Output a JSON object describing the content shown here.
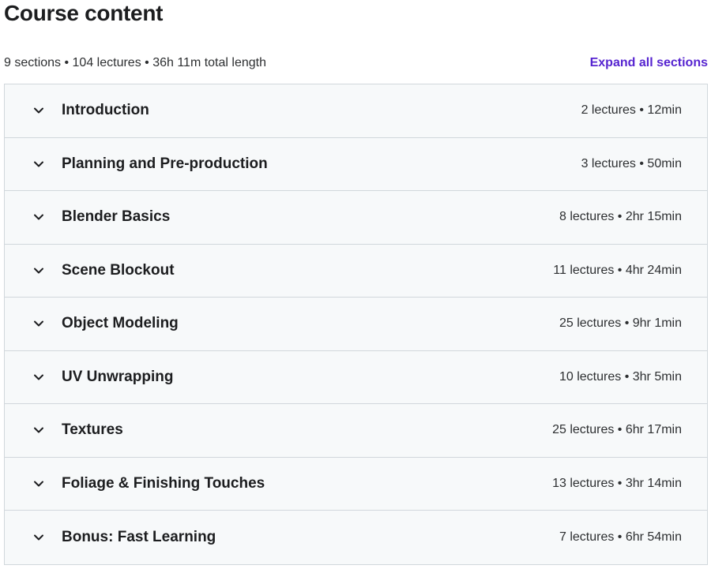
{
  "header": {
    "title": "Course content",
    "summary": "9 sections • 104 lectures • 36h 11m total length",
    "expand_label": "Expand all sections"
  },
  "colors": {
    "accent": "#5624d0",
    "section_bg": "#f7f9fa",
    "border": "#d1d7dc"
  },
  "sections": [
    {
      "title": "Introduction",
      "meta": "2 lectures • 12min"
    },
    {
      "title": "Planning and Pre-production",
      "meta": "3 lectures • 50min"
    },
    {
      "title": "Blender Basics",
      "meta": "8 lectures • 2hr 15min"
    },
    {
      "title": "Scene Blockout",
      "meta": "11 lectures • 4hr 24min"
    },
    {
      "title": "Object Modeling",
      "meta": "25 lectures • 9hr 1min"
    },
    {
      "title": "UV Unwrapping",
      "meta": "10 lectures • 3hr 5min"
    },
    {
      "title": "Textures",
      "meta": "25 lectures • 6hr 17min"
    },
    {
      "title": "Foliage & Finishing Touches",
      "meta": "13 lectures • 3hr 14min"
    },
    {
      "title": "Bonus: Fast Learning",
      "meta": "7 lectures • 6hr 54min"
    }
  ]
}
